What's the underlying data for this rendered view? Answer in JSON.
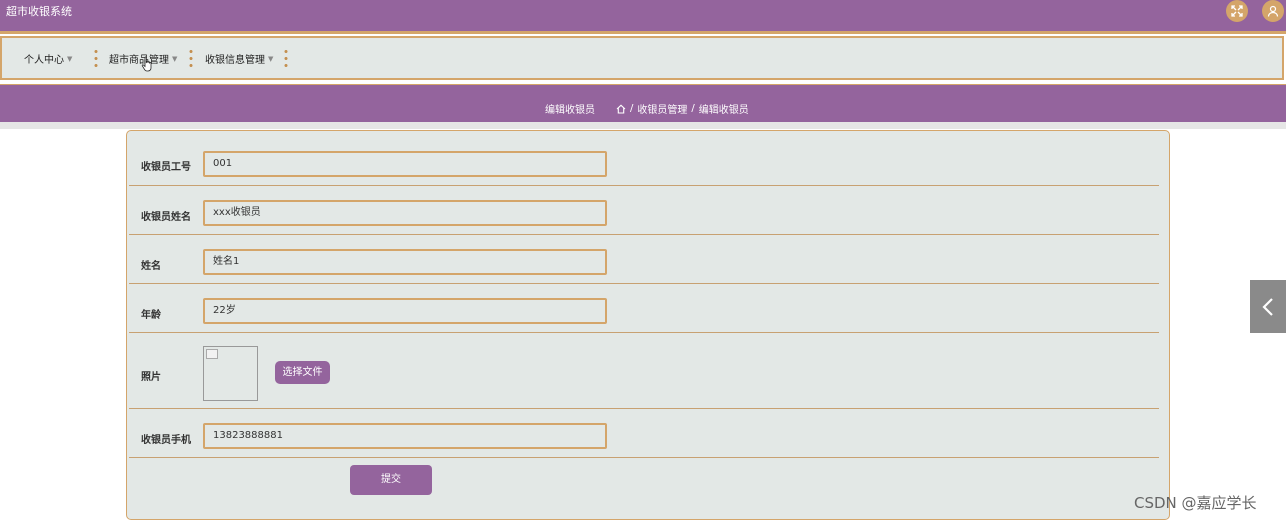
{
  "app": {
    "title": "超市收银系统"
  },
  "nav": {
    "items": [
      {
        "label": "个人中心"
      },
      {
        "label": "超市商品管理"
      },
      {
        "label": "收银信息管理"
      }
    ]
  },
  "breadcrumb": {
    "page_name": "编辑收银员",
    "path": [
      "收银员管理",
      "编辑收银员"
    ],
    "separator": "/"
  },
  "form": {
    "fields": [
      {
        "label": "收银员工号",
        "value": "001"
      },
      {
        "label": "收银员姓名",
        "value": "xxx收银员"
      },
      {
        "label": "姓名",
        "value": "姓名1"
      },
      {
        "label": "年龄",
        "value": "22岁"
      },
      {
        "label": "照片",
        "button": "选择文件"
      },
      {
        "label": "收银员手机",
        "value": "13823888881"
      }
    ],
    "submit_label": "提交"
  },
  "watermark": "CSDN @嘉应学长",
  "colors": {
    "primary": "#94649d",
    "accent": "#d4a56a",
    "panel": "#e3e8e6"
  }
}
